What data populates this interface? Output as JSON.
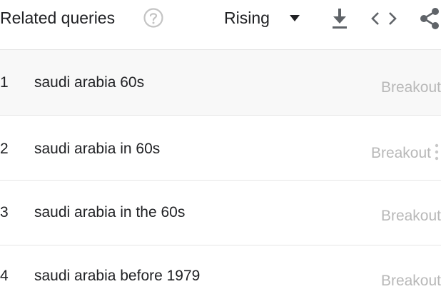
{
  "header": {
    "title": "Related queries",
    "help_icon": "help-circle-icon",
    "sort_selected": "Rising",
    "caret_icon": "caret-down-icon",
    "download_icon": "download-icon",
    "embed_icon": "embed-code-icon",
    "share_icon": "share-icon"
  },
  "rows": [
    {
      "rank": "1",
      "query": "saudi arabia 60s",
      "value": "Breakout"
    },
    {
      "rank": "2",
      "query": "saudi arabia in 60s",
      "value": "Breakout"
    },
    {
      "rank": "3",
      "query": "saudi arabia in the 60s",
      "value": "Breakout"
    },
    {
      "rank": "4",
      "query": "saudi arabia before 1979",
      "value": "Breakout"
    }
  ],
  "more_icon": "more-vert-icon",
  "colors": {
    "text": "#202124",
    "muted": "#b8b8b8",
    "icon": "#5f6368",
    "divider": "#e6e6e6",
    "highlight_row": "#f8f8f8"
  }
}
